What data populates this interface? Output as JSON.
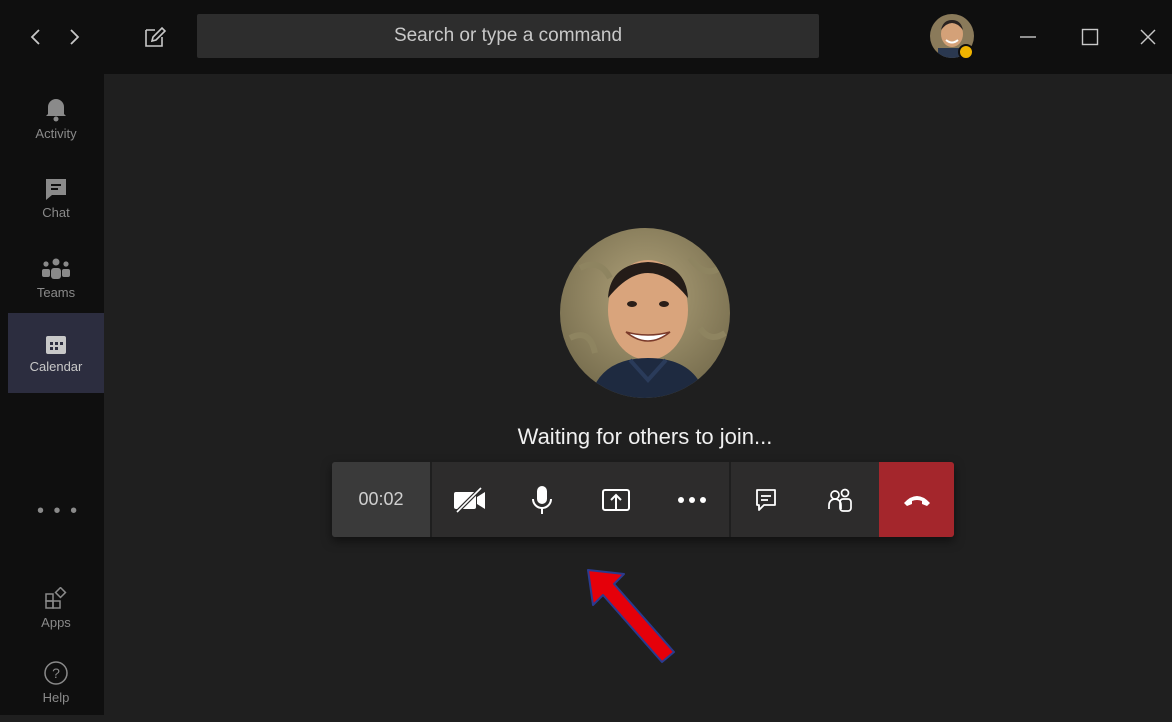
{
  "search": {
    "placeholder": "Search or type a command"
  },
  "rail": {
    "items": [
      {
        "label": "Activity",
        "icon": "bell-icon"
      },
      {
        "label": "Chat",
        "icon": "chat-icon"
      },
      {
        "label": "Teams",
        "icon": "teams-icon"
      },
      {
        "label": "Calendar",
        "icon": "calendar-icon"
      },
      {
        "label": "Apps",
        "icon": "apps-icon"
      },
      {
        "label": "Help",
        "icon": "help-icon"
      }
    ],
    "active": "Calendar",
    "more": "• • •"
  },
  "meeting": {
    "status_text": "Waiting for others to join...",
    "timer": "00:02"
  },
  "colors": {
    "background": "#1f1f1f",
    "rail": "#0f0f0f",
    "accent": "#464775",
    "hangup": "#a4262c",
    "arrow": "#e5000a"
  }
}
